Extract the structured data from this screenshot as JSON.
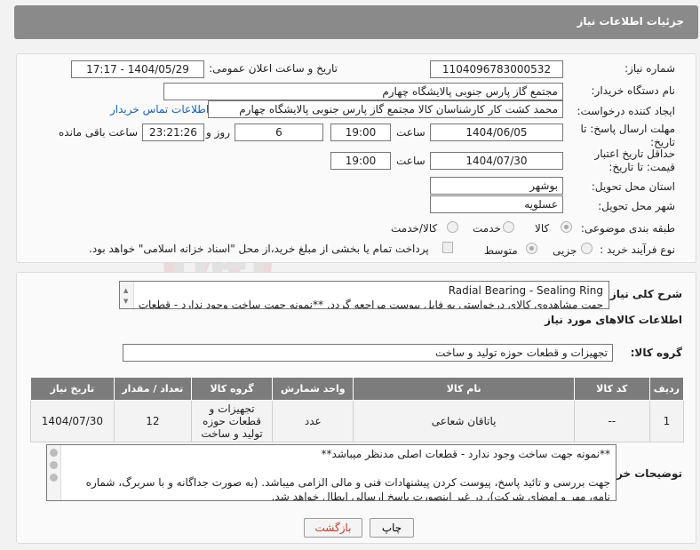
{
  "header": {
    "title": "جزئیات اطلاعات نیاز"
  },
  "labels": {
    "need_number": "شماره نیاز:",
    "announce_datetime": "تاریخ و ساعت اعلان عمومی:",
    "buyer_org": "نام دستگاه خریدار:",
    "requester": "ایجاد کننده درخواست:",
    "reply_deadline": "مهلت ارسال پاسخ: تا تاریخ:",
    "price_validity": "حداقل تاریخ اعتبار قیمت: تا تاریخ:",
    "delivery_province": "استان محل تحویل:",
    "delivery_city": "شهر محل تحویل:",
    "category": "طبقه بندی موضوعی:",
    "process_type": "نوع فرآیند خرید :",
    "time": "ساعت",
    "day_and": "روز و",
    "remaining": "ساعت باقی مانده",
    "summary": "شرح کلی نیاز:",
    "goods_info": "اطلاعات کالاهای مورد نیاز",
    "goods_group": "گروه کالا:",
    "buyer_notes": "توضیحات خریدار:"
  },
  "fields": {
    "need_number": "1104096783000532",
    "announce_datetime": "1404/05/29 - 17:17",
    "buyer_org": "مجتمع گاز پارس جنوبی  پالایشگاه چهارم",
    "requester": "محمد کشت کار کارشناسان کالا مجتمع گاز پارس جنوبی  پالایشگاه چهارم",
    "buyer_contact_link": "اطلاعات تماس خریدار",
    "reply_date": "1404/06/05",
    "reply_time": "19:00",
    "reply_days": "6",
    "reply_remaining": "23:21:26",
    "validity_date": "1404/07/30",
    "validity_time": "19:00",
    "delivery_province": "بوشهر",
    "delivery_city": "عسلویه",
    "goods_group": "تجهیزات و قطعات حوزه تولید و ساخت"
  },
  "category_options": [
    "کالا",
    "خدمت",
    "کالا/خدمت"
  ],
  "category_selected": "کالا",
  "process_options": [
    "جزیی",
    "متوسط"
  ],
  "process_selected": "متوسط",
  "payment_note": "پرداخت تمام یا بخشی از مبلغ خرید،از محل \"اسناد خزانه اسلامی\" خواهد بود.",
  "summary_lines": [
    "Radial Bearing - Sealing Ring",
    "جهت مشاهده‌ی کالای درخواستی به فایل پیوست مراجعه گردد. **نمونه جهت ساخت وجود ندارد - قطعات"
  ],
  "table": {
    "headers": [
      "ردیف",
      "کد کالا",
      "نام کالا",
      "واحد شمارش",
      "گروه کالا",
      "تعداد / مقدار",
      "تاریخ نیاز"
    ],
    "rows": [
      [
        "1",
        "--",
        "یاتاقان شعاعی",
        "عدد",
        "تجهیزات و قطعات حوزه تولید و ساخت",
        "12",
        "1404/07/30"
      ]
    ]
  },
  "notes_lines": [
    "**نمونه جهت ساخت وجود ندارد - قطعات اصلی مدنظر میباشد**",
    "",
    "جهت بررسی و تائید پاسخ، پیوست کردن پیشنهادات فنی و مالی الزامی میباشد. (به صورت جداگانه و با سربرگ، شماره",
    "نامه، مهر و امضای شرکت)، در غیر اینصورت پاسخ ارسالی ابطال خواهد شد."
  ],
  "buttons": {
    "print": "چاپ",
    "back": "بازگشت"
  },
  "watermark": "AriaTender.net",
  "colors": {
    "header_bg": "#8a8a8a",
    "table_header_bg": "#7c7c7c",
    "link": "#1a5fb4",
    "back_text": "#c0392b"
  }
}
